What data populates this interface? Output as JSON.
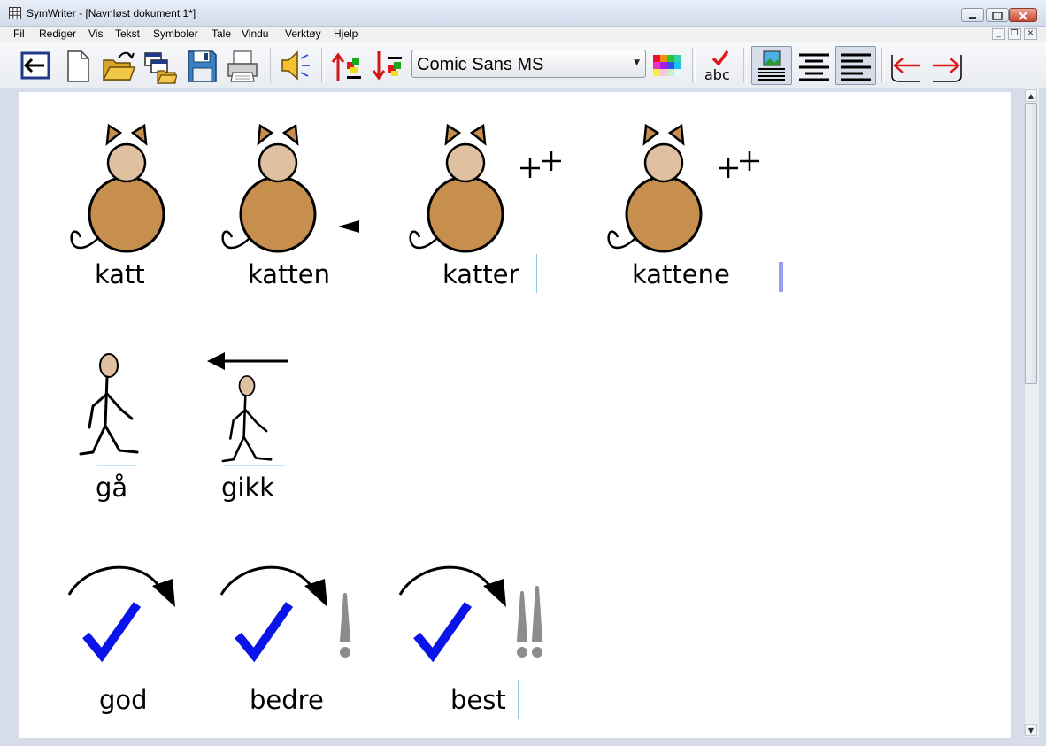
{
  "window": {
    "title": "SymWriter - [Navnløst dokument 1*]"
  },
  "menu": {
    "items": [
      "Fil",
      "Rediger",
      "Vis",
      "Tekst",
      "Symboler",
      "Tale",
      "Vindu",
      "Verktøy",
      "Hjelp"
    ]
  },
  "toolbar": {
    "font_name": "Comic Sans MS",
    "spell_label": "abc",
    "icons": [
      "exit-icon",
      "new-document-icon",
      "open-folder-icon",
      "open-multiple-icon",
      "save-icon",
      "print-icon",
      "speaker-icon",
      "symbol-up-icon",
      "symbol-down-icon",
      "font-select",
      "color-palette-icon",
      "spellcheck-icon",
      "picture-above-icon",
      "align-center-icon",
      "align-left-icon",
      "arrow-left-icon",
      "arrow-right-icon"
    ]
  },
  "document": {
    "row1": [
      "katt",
      "katten",
      "katter",
      "kattene"
    ],
    "row2": [
      "gå",
      "gikk"
    ],
    "row3": [
      "god",
      "bedre",
      "best"
    ]
  },
  "colors": {
    "cat_body": "#c68f4e",
    "cat_head": "#dfc0a0",
    "check_blue": "#0a14e8",
    "exclaim_gray": "#8c8c8c",
    "caret": "#8fc9e8",
    "text_cursor": "#9a9ef0"
  }
}
